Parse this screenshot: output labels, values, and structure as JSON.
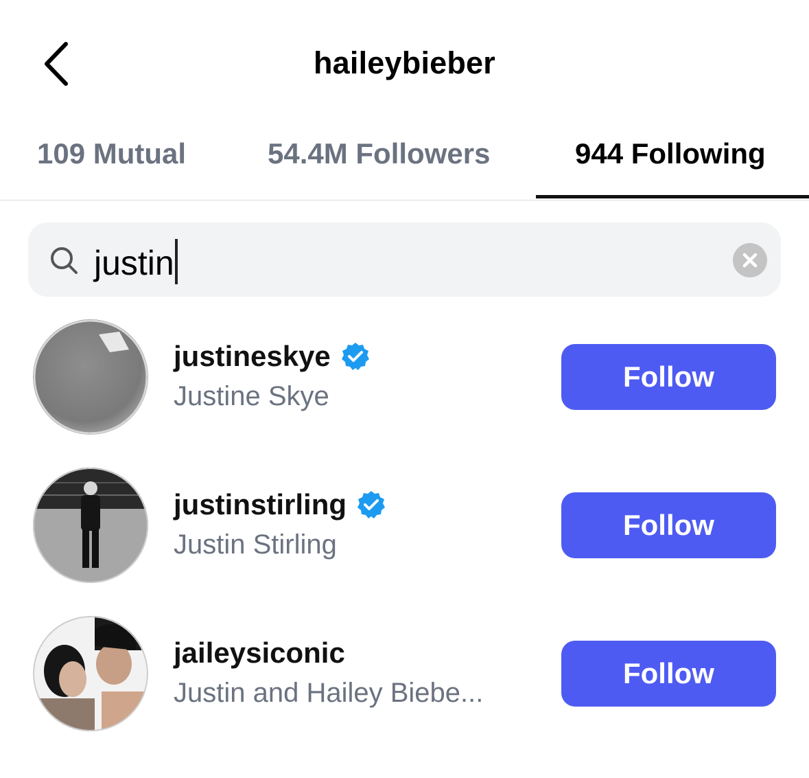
{
  "header": {
    "title": "haileybieber",
    "back_icon": "chevron-left-icon"
  },
  "tabs": [
    {
      "label": "109 Mutual",
      "active": false
    },
    {
      "label": "54.4M Followers",
      "active": false
    },
    {
      "label": "944 Following",
      "active": true
    }
  ],
  "search": {
    "value": "justin",
    "icon": "search-icon",
    "clear_icon": "clear-icon"
  },
  "results": [
    {
      "username": "justineskye",
      "full_name": "Justine Skye",
      "verified": true,
      "button": "Follow"
    },
    {
      "username": "justinstirling",
      "full_name": "Justin Stirling",
      "verified": true,
      "button": "Follow"
    },
    {
      "username": "jaileysiconic",
      "full_name": "Justin and Hailey Biebe...",
      "verified": false,
      "button": "Follow"
    }
  ],
  "colors": {
    "follow_button": "#4e5bf2",
    "verified_badge": "#1d9bf0",
    "secondary_text": "#6b7280"
  }
}
